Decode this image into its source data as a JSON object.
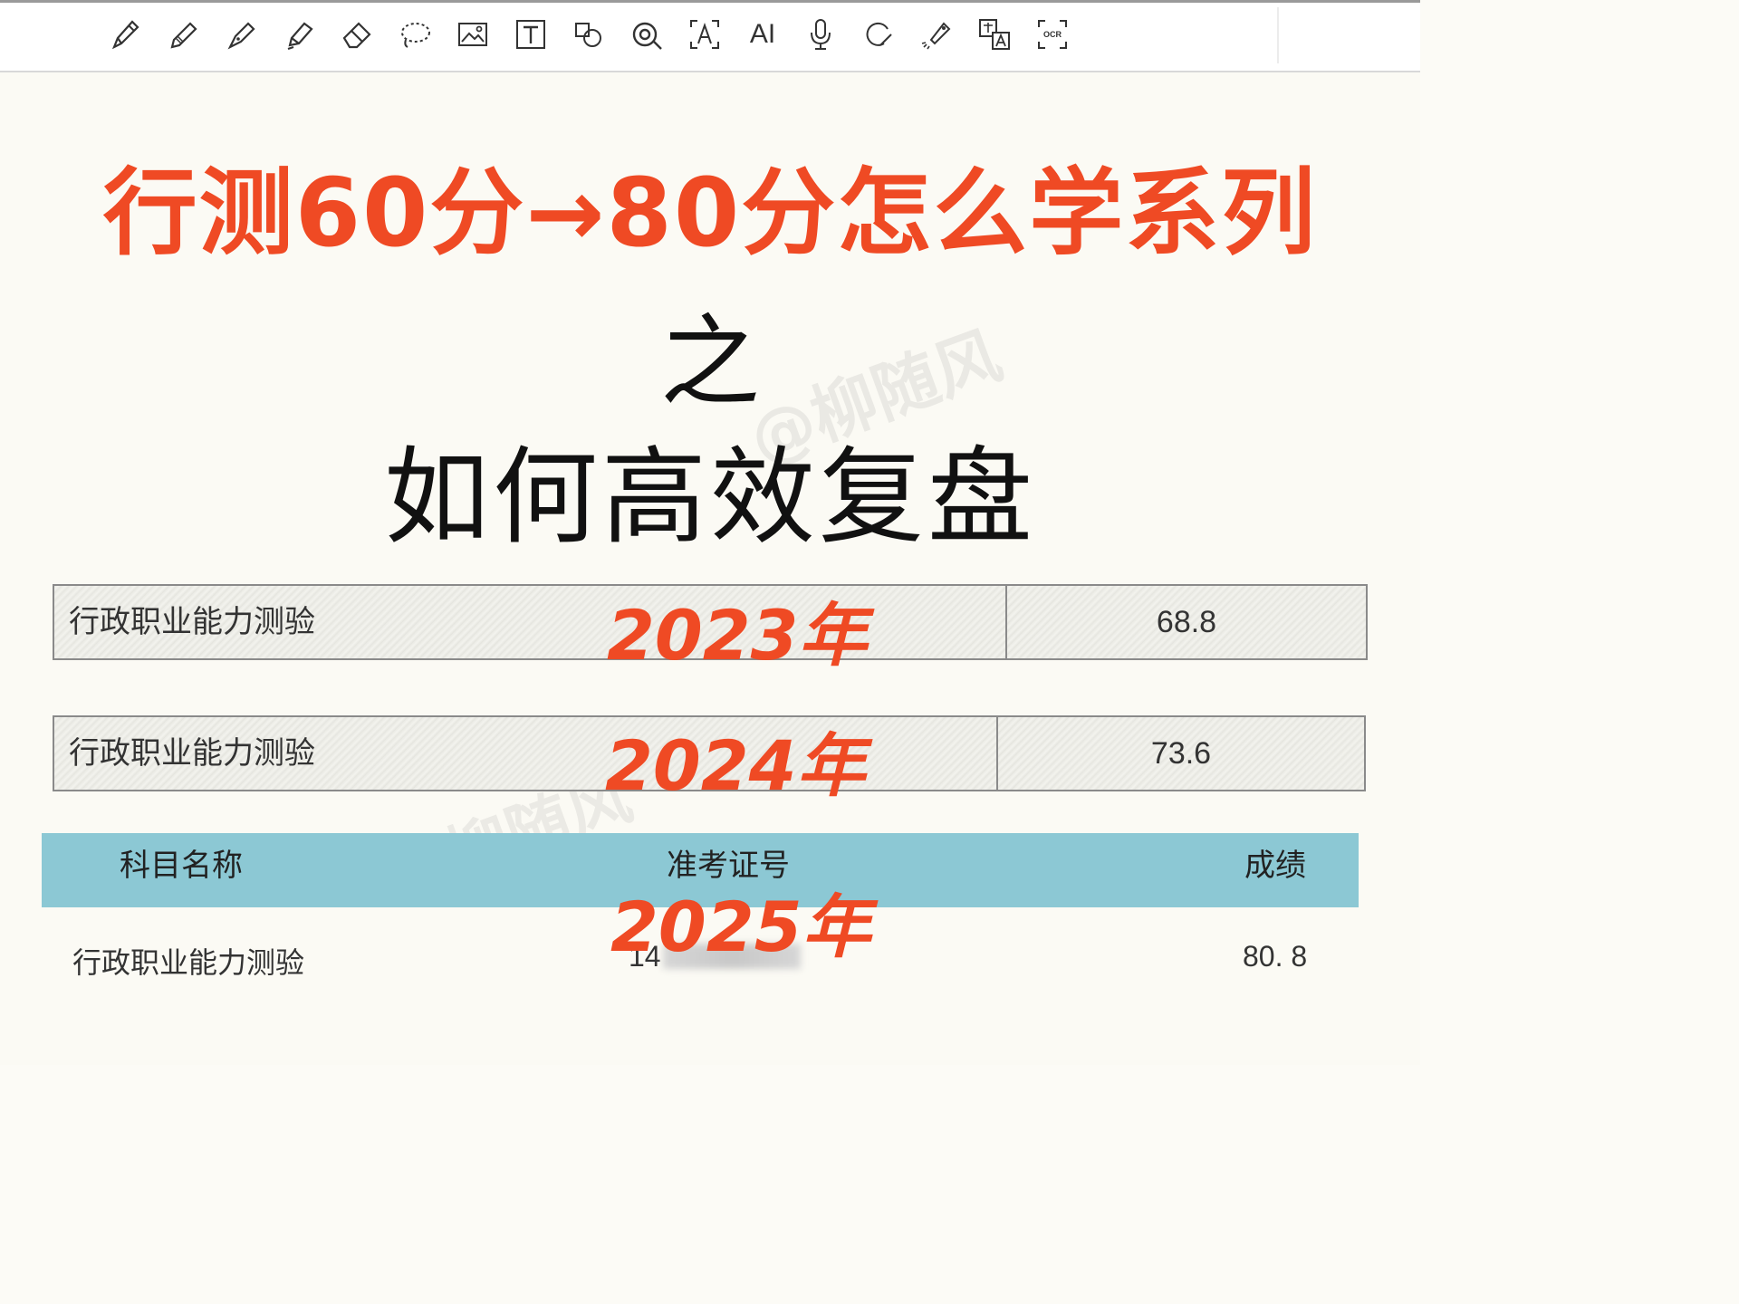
{
  "toolbar": {
    "tools": [
      {
        "icon": "pen-icon"
      },
      {
        "icon": "pencil-icon"
      },
      {
        "icon": "fountain-pen-icon"
      },
      {
        "icon": "highlighter-icon"
      },
      {
        "icon": "eraser-icon"
      },
      {
        "icon": "lasso-icon"
      },
      {
        "icon": "image-icon"
      },
      {
        "icon": "text-box-icon"
      },
      {
        "icon": "shapes-icon"
      },
      {
        "icon": "sticker-icon"
      },
      {
        "icon": "text-recognition-icon"
      },
      {
        "icon": "ai-icon",
        "label": "AI"
      },
      {
        "icon": "microphone-icon"
      },
      {
        "icon": "shape-draw-icon"
      },
      {
        "icon": "laser-pointer-icon"
      },
      {
        "icon": "translate-icon"
      },
      {
        "icon": "ocr-icon",
        "label": "OCR"
      }
    ]
  },
  "slide": {
    "title_red": "行测60分→80分怎么学系列",
    "title_zhi": "之",
    "title_black": "如何高效复盘",
    "watermark": "@柳随风"
  },
  "scores": [
    {
      "subject": "行政职业能力测验",
      "year": "2023年",
      "score": "68.8"
    },
    {
      "subject": "行政职业能力测验",
      "year": "2024年",
      "score": "73.6"
    }
  ],
  "table_2025": {
    "headers": {
      "subject": "科目名称",
      "ticket": "准考证号",
      "score": "成绩"
    },
    "year": "2025年",
    "row": {
      "subject": "行政职业能力测验",
      "ticket_prefix": "14",
      "score": "80. 8"
    }
  },
  "colors": {
    "accent_red": "#ef4a24",
    "header_teal": "#8cc8d4",
    "text_dark": "#111111"
  }
}
